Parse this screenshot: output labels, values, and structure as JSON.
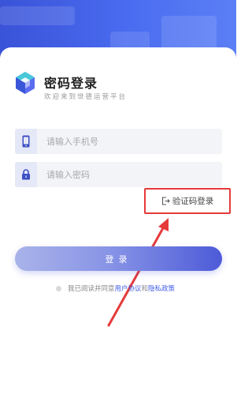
{
  "page": {
    "title": "密码登录",
    "subtitle": "欢迎来到世德运营平台"
  },
  "form": {
    "phone_placeholder": "请输入手机号",
    "password_placeholder": "请输入密码",
    "code_login_label": "验证码登录",
    "login_button_label": "登录"
  },
  "agreement": {
    "prefix": "我已阅读并同意",
    "user_agreement": "用户协议",
    "and": "和",
    "privacy_policy": "隐私政策"
  },
  "colors": {
    "brand_blue": "#3f5ee6",
    "highlight_red": "#e53a3a"
  },
  "icons": {
    "logo": "app-logo",
    "phone": "phone-icon",
    "lock": "lock-icon",
    "code_login": "login-exit-icon"
  }
}
